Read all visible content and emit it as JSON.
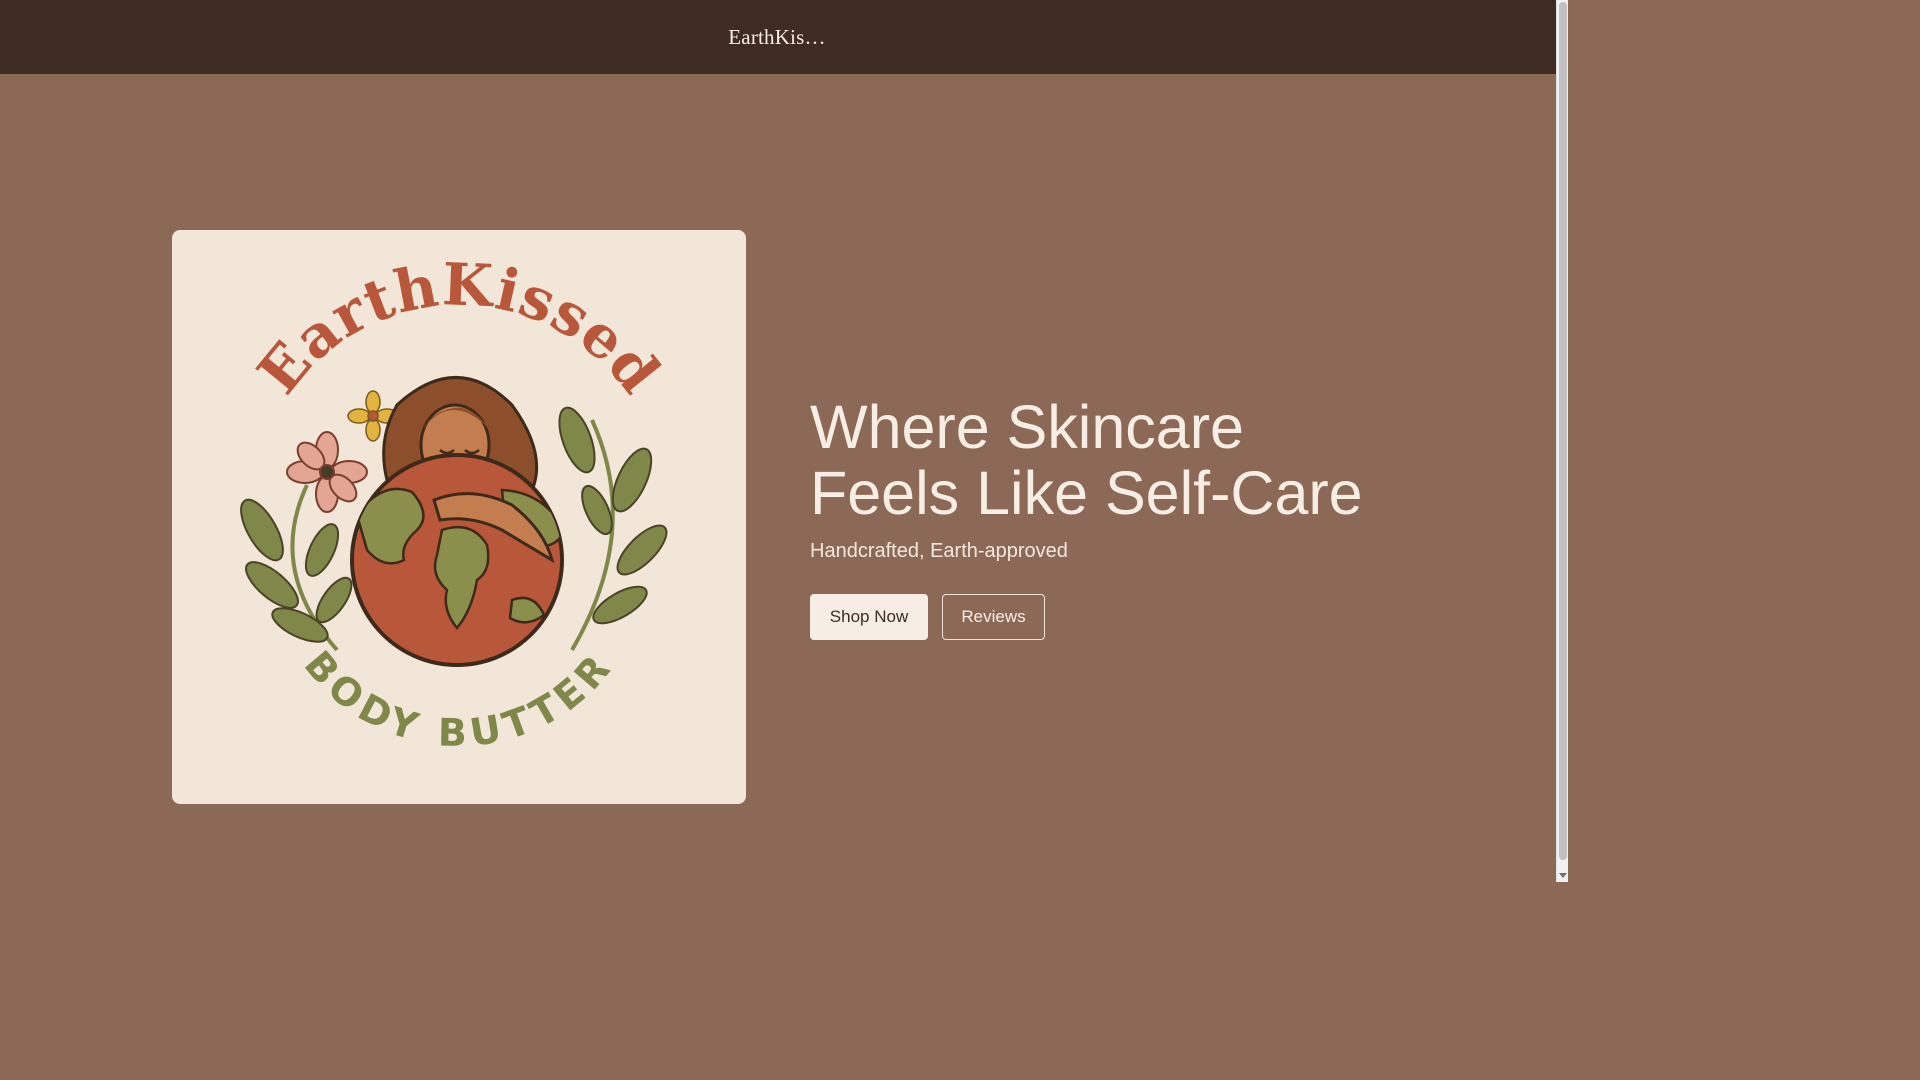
{
  "header": {
    "brand": "EarthKis…"
  },
  "hero": {
    "logo": {
      "arc_text_top": "EarthKissed",
      "arc_text_bottom": "BODY BUTTER"
    },
    "headline_line1": "Where Skincare",
    "headline_line2": "Feels Like Self-Care",
    "subheadline": "Handcrafted, Earth-approved",
    "shop_button": "Shop Now",
    "reviews_button": "Reviews"
  },
  "colors": {
    "page_bg": "#8c6856",
    "header_bg": "#3e2c22",
    "card_bg": "#f1e6d8",
    "logo_terracotta": "#b9573a",
    "logo_olive": "#7f8749",
    "logo_hair": "#8d4f2b"
  }
}
